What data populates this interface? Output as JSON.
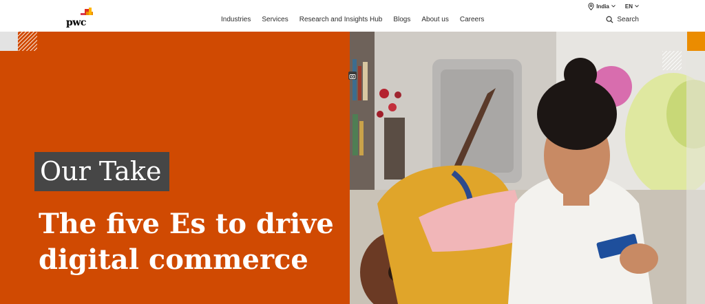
{
  "header": {
    "logo_text": "pwc",
    "utility": {
      "region_label": "India",
      "language_label": "EN"
    },
    "nav": [
      {
        "label": "Industries"
      },
      {
        "label": "Services"
      },
      {
        "label": "Research and Insights Hub"
      },
      {
        "label": "Blogs"
      },
      {
        "label": "About us"
      },
      {
        "label": "Careers"
      }
    ],
    "search_label": "Search"
  },
  "hero": {
    "tag": "Our Take",
    "headline": "The five Es to drive digital commerce",
    "background_color": "#d04a02",
    "image_description_icon": "image-icon"
  },
  "colors": {
    "brand_orange": "#d04a02",
    "tag_bg": "#464646",
    "accent_orange": "#eb8c00"
  }
}
